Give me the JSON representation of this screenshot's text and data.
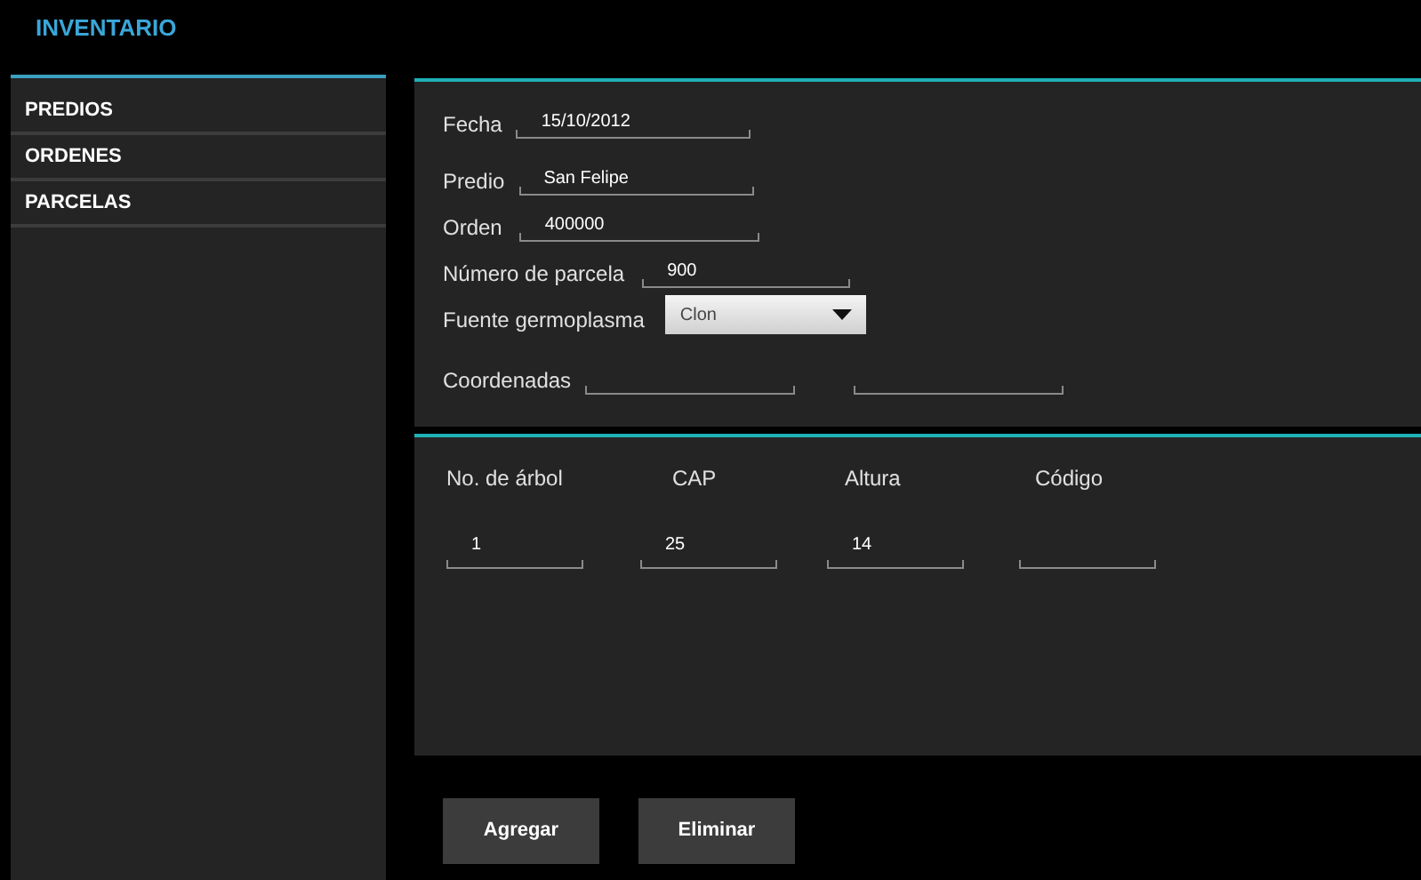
{
  "app_title": "INVENTARIO",
  "sidebar": {
    "items": [
      {
        "label": "PREDIOS"
      },
      {
        "label": "ORDENES"
      },
      {
        "label": "PARCELAS"
      }
    ]
  },
  "form": {
    "fields": [
      {
        "kind": "text",
        "label": "Fecha",
        "value": "15/10/2012"
      },
      {
        "kind": "text",
        "label": "Predio",
        "value": "San Felipe"
      },
      {
        "kind": "text",
        "label": "Orden",
        "value": "400000"
      },
      {
        "kind": "text",
        "label": "Número de parcela",
        "value": "900"
      },
      {
        "kind": "dropdown",
        "label": "Fuente germoplasma",
        "value": "Clon"
      },
      {
        "kind": "pair",
        "label": "Coordenadas"
      }
    ]
  },
  "table": {
    "columns": [
      {
        "header": "No. de árbol",
        "value": "1"
      },
      {
        "header": "CAP",
        "value": "25"
      },
      {
        "header": "Altura",
        "value": "14"
      },
      {
        "header": "Código"
      }
    ]
  },
  "buttons": [
    "Agregar",
    "Eliminar"
  ]
}
